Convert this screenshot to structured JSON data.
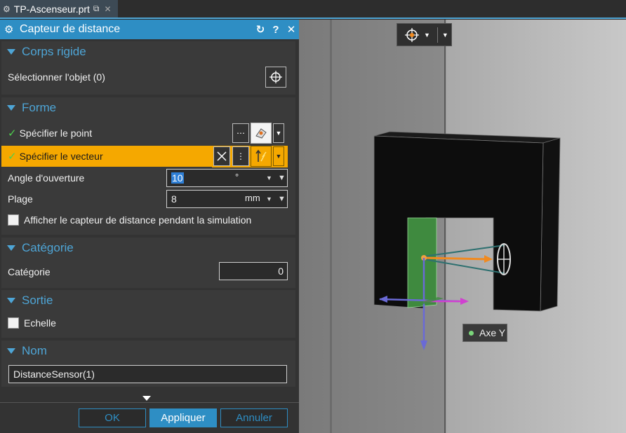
{
  "tab": {
    "title": "TP-Ascenseur.prt"
  },
  "dialog": {
    "title": "Capteur de distance",
    "sections": {
      "rigid": {
        "title": "Corps rigide",
        "select_label": "Sélectionner l'objet (0)"
      },
      "shape": {
        "title": "Forme",
        "point_label": "Spécifier le point",
        "vector_label": "Spécifier le vecteur",
        "angle_label": "Angle d'ouverture",
        "angle_value": "10",
        "angle_unit": "°",
        "range_label": "Plage",
        "range_value": "8",
        "range_unit": "mm",
        "show_label": "Afficher le capteur de distance pendant la simulation"
      },
      "category": {
        "title": "Catégorie",
        "label": "Catégorie",
        "value": "0"
      },
      "output": {
        "title": "Sortie",
        "scale_label": "Echelle"
      },
      "name": {
        "title": "Nom",
        "value": "DistanceSensor(1)"
      }
    },
    "buttons": {
      "ok": "OK",
      "apply": "Appliquer",
      "cancel": "Annuler"
    }
  },
  "viewport": {
    "axis_label": "Axe Y"
  },
  "colors": {
    "accent": "#2e8ec4",
    "highlight": "#f5a800",
    "check": "#4ecf4e"
  }
}
